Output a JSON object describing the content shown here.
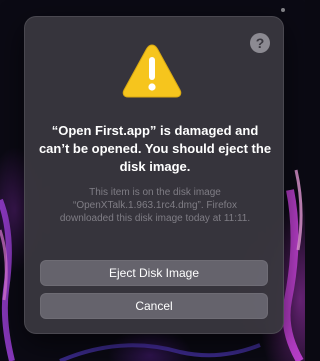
{
  "dialog": {
    "title": "“Open First.app” is damaged and can’t be opened. You should eject the disk image.",
    "info": "This item is on the disk image “OpenXTalk.1.963.1rc4.dmg”. Firefox downloaded this disk image today at 11:11.",
    "help_label": "?",
    "eject_label": "Eject Disk Image",
    "cancel_label": "Cancel",
    "icon": "warning-triangle-icon"
  },
  "colors": {
    "warning_yellow": "#f6c51d",
    "dialog_bg": "#3a3840",
    "button_bg": "#8c8a96"
  }
}
